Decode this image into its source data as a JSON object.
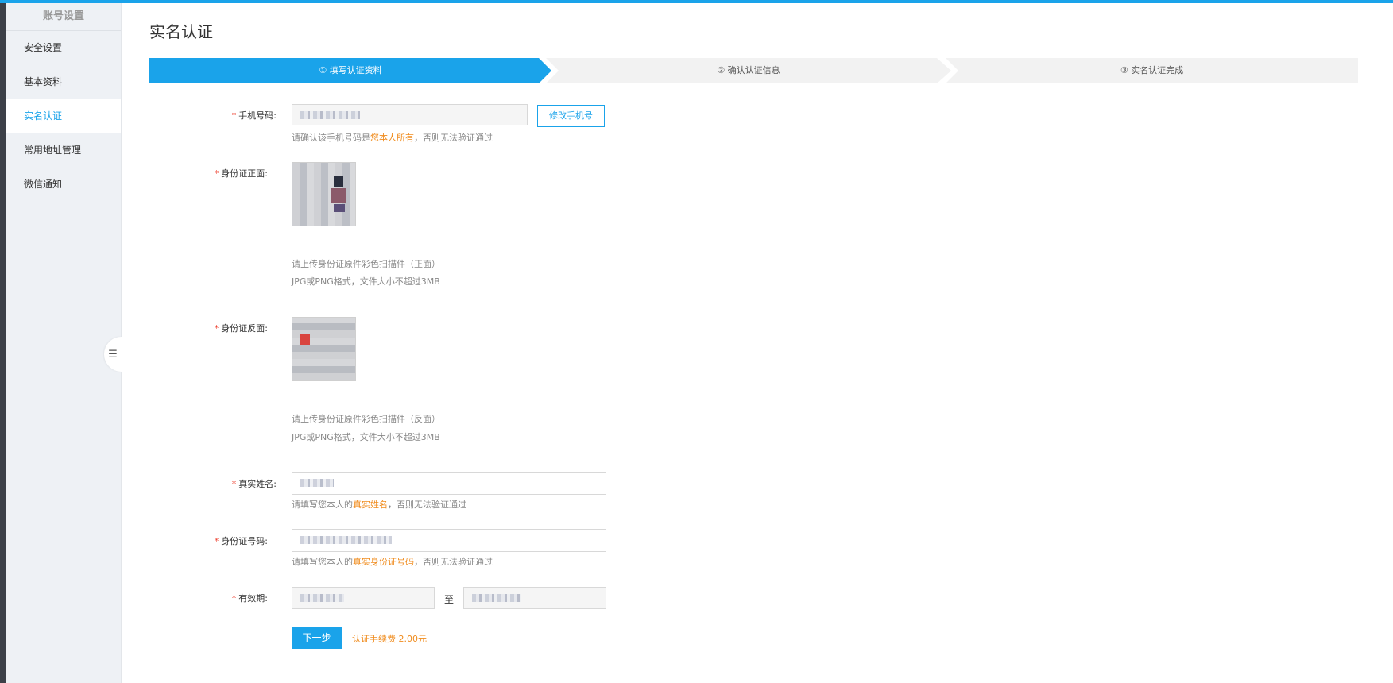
{
  "sidebar": {
    "title": "账号设置",
    "items": [
      {
        "label": "安全设置"
      },
      {
        "label": "基本资料"
      },
      {
        "label": "实名认证"
      },
      {
        "label": "常用地址管理"
      },
      {
        "label": "微信通知"
      }
    ],
    "active_index": 2
  },
  "page": {
    "title": "实名认证"
  },
  "steps": [
    {
      "label": "① 填写认证资料",
      "active": true
    },
    {
      "label": "② 确认认证信息",
      "active": false
    },
    {
      "label": "③ 实名认证完成",
      "active": false
    }
  ],
  "form": {
    "phone": {
      "label": "手机号码:",
      "change_button": "修改手机号",
      "hint_pre": "请确认该手机号码是",
      "hint_hl": "您本人所有",
      "hint_post": "，否则无法验证通过"
    },
    "id_front": {
      "label": "身份证正面:",
      "hint1": "请上传身份证原件彩色扫描件（正面）",
      "hint2": "JPG或PNG格式，文件大小不超过3MB"
    },
    "id_back": {
      "label": "身份证反面:",
      "hint1": "请上传身份证原件彩色扫描件（反面）",
      "hint2": "JPG或PNG格式，文件大小不超过3MB"
    },
    "real_name": {
      "label": "真实姓名:",
      "hint_pre": "请填写您本人的",
      "hint_hl": "真实姓名",
      "hint_post": "，否则无法验证通过"
    },
    "id_number": {
      "label": "身份证号码:",
      "hint_pre": "请填写您本人的",
      "hint_hl": "真实身份证号码",
      "hint_post": "，否则无法验证通过"
    },
    "validity": {
      "label": "有效期:",
      "separator": "至"
    },
    "required_mark": "*",
    "next_button": "下一步",
    "fee_text": "认证手续费 2.00元"
  },
  "colors": {
    "accent": "#1aa3ea",
    "highlight": "#f08c1e",
    "required": "#e43333"
  },
  "icons": {
    "collapse": "list-collapse-icon"
  }
}
